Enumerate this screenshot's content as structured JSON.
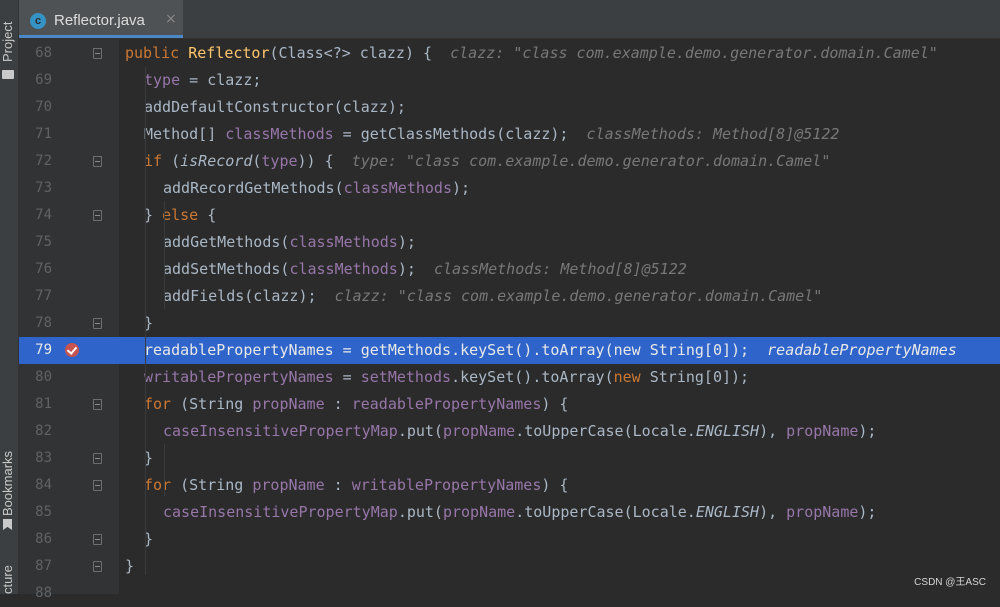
{
  "sidebar": {
    "project_label": "Project",
    "bookmarks_label": "Bookmarks",
    "structure_label": "cture"
  },
  "tab": {
    "icon_letter": "c",
    "title": "Reflector.java",
    "close": "×"
  },
  "editor": {
    "breakpoint_line": 79,
    "lines": [
      {
        "num": "68",
        "code": "public Reflector(Class<?> clazz) {",
        "hint": "clazz: \"class com.example.demo.generator.domain.Camel\""
      },
      {
        "num": "69",
        "code": "type = clazz;",
        "hint": ""
      },
      {
        "num": "70",
        "code": "addDefaultConstructor(clazz);",
        "hint": ""
      },
      {
        "num": "71",
        "code": "Method[] classMethods = getClassMethods(clazz);",
        "hint": "classMethods: Method[8]@5122"
      },
      {
        "num": "72",
        "code": "if (isRecord(type)) {",
        "hint": "type: \"class com.example.demo.generator.domain.Camel\""
      },
      {
        "num": "73",
        "code": "addRecordGetMethods(classMethods);",
        "hint": ""
      },
      {
        "num": "74",
        "code": "} else {",
        "hint": ""
      },
      {
        "num": "75",
        "code": "addGetMethods(classMethods);",
        "hint": ""
      },
      {
        "num": "76",
        "code": "addSetMethods(classMethods);",
        "hint": "classMethods: Method[8]@5122"
      },
      {
        "num": "77",
        "code": "addFields(clazz);",
        "hint": "clazz: \"class com.example.demo.generator.domain.Camel\""
      },
      {
        "num": "78",
        "code": "}",
        "hint": ""
      },
      {
        "num": "79",
        "code": "readablePropertyNames = getMethods.keySet().toArray(new String[0]);",
        "hint": "readablePropertyNames"
      },
      {
        "num": "80",
        "code": "writablePropertyNames = setMethods.keySet().toArray(new String[0]);",
        "hint": ""
      },
      {
        "num": "81",
        "code": "for (String propName : readablePropertyNames) {",
        "hint": ""
      },
      {
        "num": "82",
        "code": "caseInsensitivePropertyMap.put(propName.toUpperCase(Locale.ENGLISH), propName);",
        "hint": ""
      },
      {
        "num": "83",
        "code": "}",
        "hint": ""
      },
      {
        "num": "84",
        "code": "for (String propName : writablePropertyNames) {",
        "hint": ""
      },
      {
        "num": "85",
        "code": "caseInsensitivePropertyMap.put(propName.toUpperCase(Locale.ENGLISH), propName);",
        "hint": ""
      },
      {
        "num": "86",
        "code": "}",
        "hint": ""
      },
      {
        "num": "87",
        "code": "}",
        "hint": ""
      },
      {
        "num": "88",
        "code": "",
        "hint": ""
      }
    ]
  },
  "watermark": "CSDN @王ASC",
  "colors": {
    "background": "#2b2b2b",
    "keyword": "#cc7832",
    "method": "#ffc66d",
    "field": "#9876aa",
    "hint": "#787878",
    "current_line": "#2f65ca",
    "breakpoint": "#c75450"
  }
}
